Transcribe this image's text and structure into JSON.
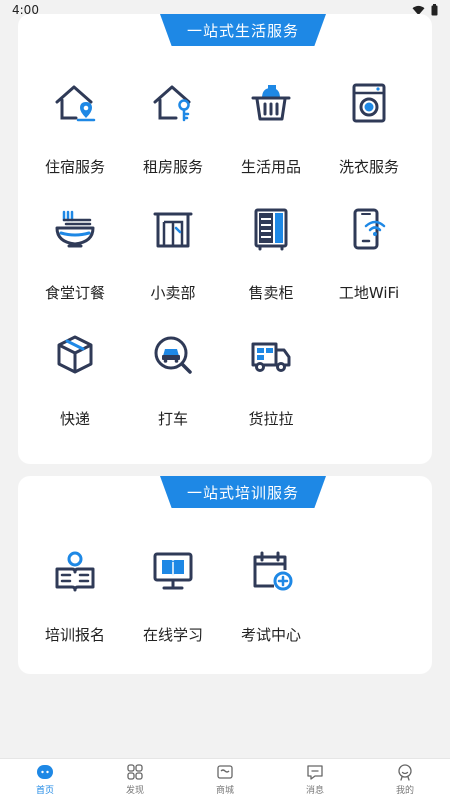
{
  "status_bar": {
    "time": "4:00",
    "icons": [
      "wifi-icon",
      "battery-icon"
    ]
  },
  "life_services": {
    "title": "一站式生活服务",
    "items": [
      {
        "label": "住宿服务",
        "icon": "house-location-icon"
      },
      {
        "label": "租房服务",
        "icon": "house-key-icon"
      },
      {
        "label": "生活用品",
        "icon": "basket-icon"
      },
      {
        "label": "洗衣服务",
        "icon": "washing-machine-icon"
      },
      {
        "label": "食堂订餐",
        "icon": "bowl-icon"
      },
      {
        "label": "小卖部",
        "icon": "shop-door-icon"
      },
      {
        "label": "售卖柜",
        "icon": "vending-cabinet-icon"
      },
      {
        "label": "工地WiFi",
        "icon": "phone-wifi-icon"
      },
      {
        "label": "快递",
        "icon": "package-icon"
      },
      {
        "label": "打车",
        "icon": "taxi-search-icon"
      },
      {
        "label": "货拉拉",
        "icon": "truck-icon"
      }
    ]
  },
  "training_services": {
    "title": "一站式培训服务",
    "items": [
      {
        "label": "培训报名",
        "icon": "person-book-icon"
      },
      {
        "label": "在线学习",
        "icon": "monitor-book-icon"
      },
      {
        "label": "考试中心",
        "icon": "calendar-plus-icon"
      }
    ]
  },
  "tab_bar": {
    "tabs": [
      {
        "label": "首页",
        "icon": "home-tab-icon",
        "active": true
      },
      {
        "label": "发现",
        "icon": "discover-grid-icon",
        "active": false
      },
      {
        "label": "商城",
        "icon": "mall-icon",
        "active": false
      },
      {
        "label": "消息",
        "icon": "message-icon",
        "active": false
      },
      {
        "label": "我的",
        "icon": "profile-icon",
        "active": false
      }
    ]
  },
  "colors": {
    "accent": "#1e88e5",
    "icon_dark": "#2f3a57",
    "background": "#f2f2f2"
  }
}
